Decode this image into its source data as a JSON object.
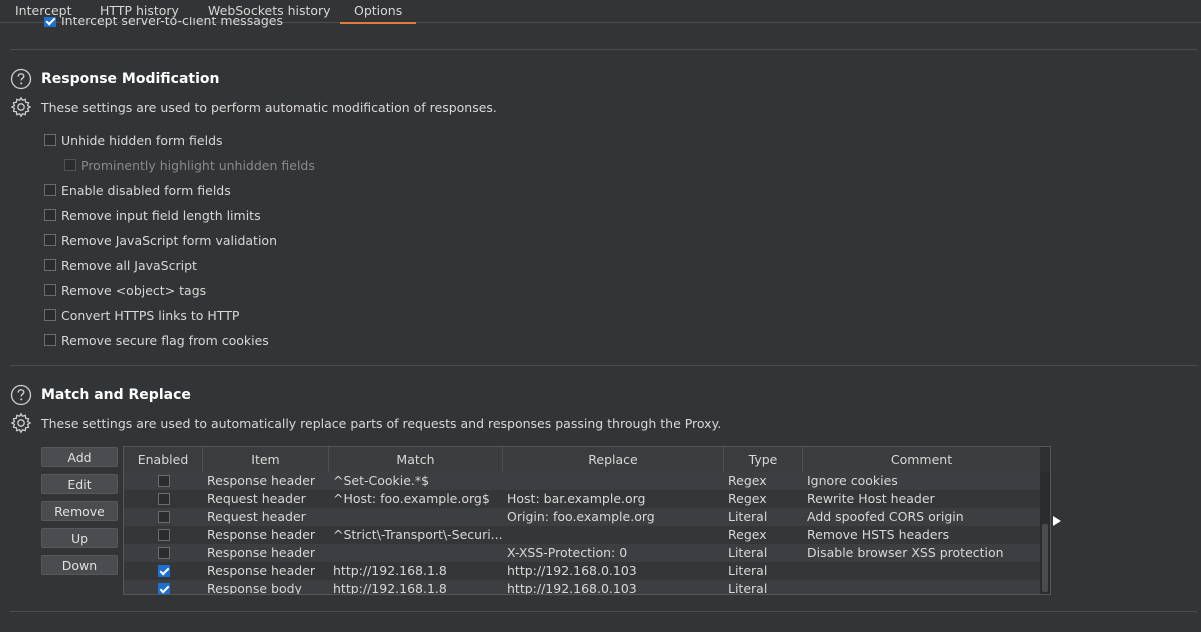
{
  "tabs": [
    {
      "label": "Intercept",
      "active": false
    },
    {
      "label": "HTTP history",
      "active": false
    },
    {
      "label": "WebSockets history",
      "active": false
    },
    {
      "label": "Options",
      "active": true
    }
  ],
  "accent_color": "#e07b39",
  "partial_option": {
    "label": "Intercept server-to-client messages",
    "checked": true
  },
  "response_modification": {
    "title": "Response Modification",
    "description": "These settings are used to perform automatic modification of responses.",
    "options": [
      {
        "label": "Unhide hidden form fields",
        "checked": false,
        "disabled": false
      },
      {
        "label": "Prominently highlight unhidden fields",
        "checked": false,
        "disabled": true
      },
      {
        "label": "Enable disabled form fields",
        "checked": false,
        "disabled": false
      },
      {
        "label": "Remove input field length limits",
        "checked": false,
        "disabled": false
      },
      {
        "label": "Remove JavaScript form validation",
        "checked": false,
        "disabled": false
      },
      {
        "label": "Remove all JavaScript",
        "checked": false,
        "disabled": false
      },
      {
        "label": "Remove <object> tags",
        "checked": false,
        "disabled": false
      },
      {
        "label": "Convert HTTPS links to HTTP",
        "checked": false,
        "disabled": false
      },
      {
        "label": "Remove secure flag from cookies",
        "checked": false,
        "disabled": false
      }
    ]
  },
  "match_replace": {
    "title": "Match and Replace",
    "description": "These settings are used to automatically replace parts of requests and responses passing through the Proxy.",
    "buttons": {
      "add": "Add",
      "edit": "Edit",
      "remove": "Remove",
      "up": "Up",
      "down": "Down"
    },
    "columns": [
      "Enabled",
      "Item",
      "Match",
      "Replace",
      "Type",
      "Comment"
    ],
    "rows": [
      {
        "enabled": false,
        "item": "Response header",
        "match": "^Set-Cookie.*$",
        "replace": "",
        "type": "Regex",
        "comment": "Ignore cookies"
      },
      {
        "enabled": false,
        "item": "Request header",
        "match": "^Host: foo.example.org$",
        "replace": "Host: bar.example.org",
        "type": "Regex",
        "comment": "Rewrite Host header"
      },
      {
        "enabled": false,
        "item": "Request header",
        "match": "",
        "replace": "Origin: foo.example.org",
        "type": "Literal",
        "comment": "Add spoofed CORS origin"
      },
      {
        "enabled": false,
        "item": "Response header",
        "match": "^Strict\\-Transport\\-Securi...",
        "replace": "",
        "type": "Regex",
        "comment": "Remove HSTS headers"
      },
      {
        "enabled": false,
        "item": "Response header",
        "match": "",
        "replace": "X-XSS-Protection: 0",
        "type": "Literal",
        "comment": "Disable browser XSS protection"
      },
      {
        "enabled": true,
        "item": "Response header",
        "match": "http://192.168.1.8",
        "replace": "http://192.168.0.103",
        "type": "Literal",
        "comment": ""
      },
      {
        "enabled": true,
        "item": "Response body",
        "match": "http://192.168.1.8",
        "replace": "http://192.168.0.103",
        "type": "Literal",
        "comment": ""
      }
    ]
  }
}
